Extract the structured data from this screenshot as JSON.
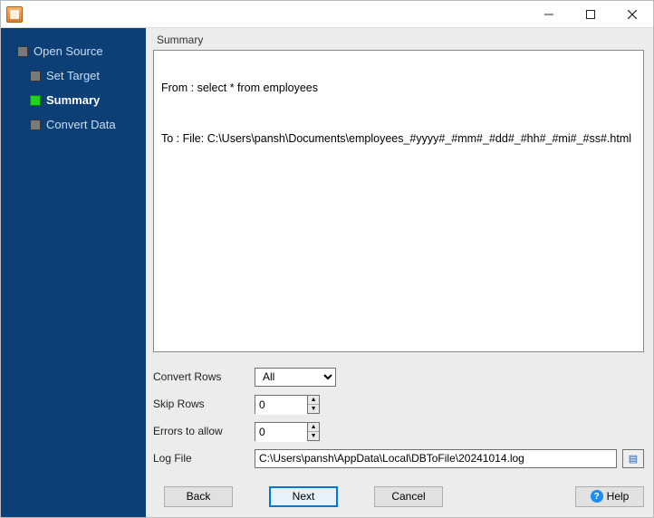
{
  "sidebar": {
    "items": [
      {
        "label": "Open Source",
        "active": false
      },
      {
        "label": "Set Target",
        "active": false
      },
      {
        "label": "Summary",
        "active": true
      },
      {
        "label": "Convert Data",
        "active": false
      }
    ]
  },
  "main": {
    "group_label": "Summary",
    "summary_lines": {
      "from": "From : select * from employees",
      "to": "To : File: C:\\Users\\pansh\\Documents\\employees_#yyyy#_#mm#_#dd#_#hh#_#mi#_#ss#.html"
    },
    "form": {
      "convert_rows_label": "Convert Rows",
      "convert_rows_value": "All",
      "skip_rows_label": "Skip Rows",
      "skip_rows_value": "0",
      "errors_label": "Errors to allow",
      "errors_value": "0",
      "logfile_label": "Log File",
      "logfile_value": "C:\\Users\\pansh\\AppData\\Local\\DBToFile\\20241014.log"
    }
  },
  "buttons": {
    "back": "Back",
    "next": "Next",
    "cancel": "Cancel",
    "help": "Help"
  }
}
